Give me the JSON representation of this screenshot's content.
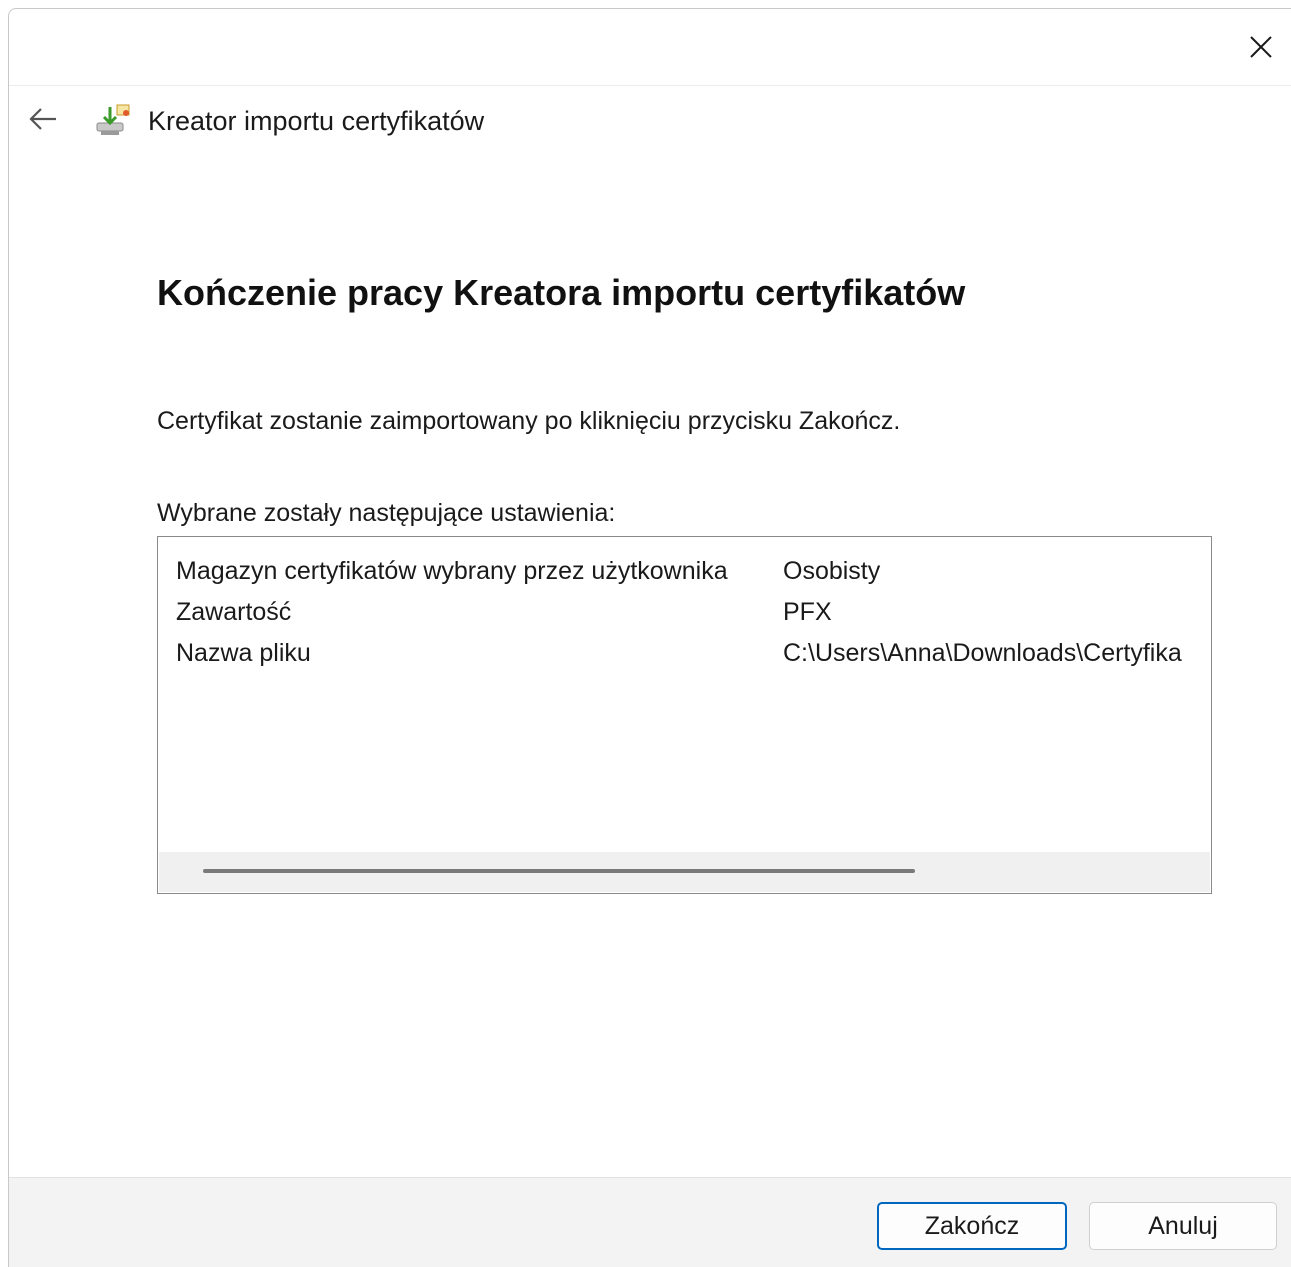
{
  "window": {
    "close_icon": "close-icon",
    "back_icon": "back-arrow-icon",
    "wizard_icon": "certificate-wizard-icon",
    "wizard_title": "Kreator importu certyfikatów"
  },
  "main": {
    "heading": "Kończenie pracy Kreatora importu certyfikatów",
    "info": "Certyfikat zostanie zaimportowany po kliknięciu przycisku Zakończ.",
    "settings_label": "Wybrane zostały następujące ustawienia:",
    "settings": [
      {
        "key": "Magazyn certyfikatów wybrany przez użytkownika",
        "value": "Osobisty"
      },
      {
        "key": "Zawartość",
        "value": "PFX"
      },
      {
        "key": "Nazwa pliku",
        "value": "C:\\Users\\Anna\\Downloads\\Certyfika"
      }
    ]
  },
  "footer": {
    "finish_label": "Zakończ",
    "cancel_label": "Anuluj"
  },
  "colors": {
    "accent": "#0067c0",
    "footer_bg": "#f3f3f3"
  }
}
